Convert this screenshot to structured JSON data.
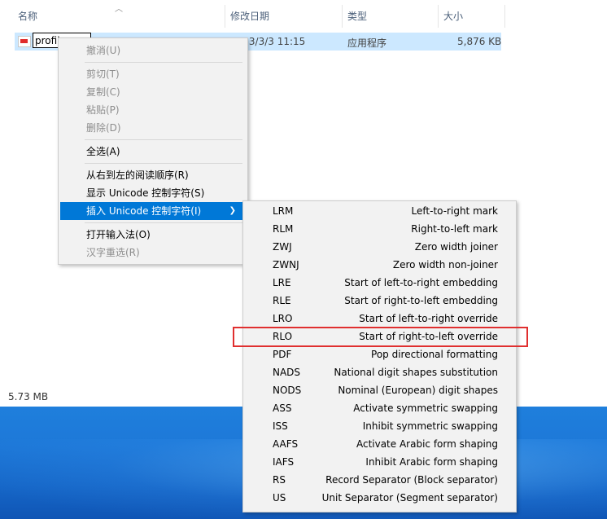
{
  "columns": {
    "name": "名称",
    "modified": "修改日期",
    "type": "类型",
    "size": "大小"
  },
  "file": {
    "rename_value": "profil",
    "modified": "2023/3/3 11:15",
    "type": "应用程序",
    "size": "5,876 KB"
  },
  "status": {
    "selected_size": "5.73 MB"
  },
  "context_menu": {
    "items": [
      {
        "label": "撤消(U)",
        "disabled": true
      },
      {
        "label": "剪切(T)",
        "disabled": true
      },
      {
        "label": "复制(C)",
        "disabled": true
      },
      {
        "label": "粘贴(P)",
        "disabled": true
      },
      {
        "label": "删除(D)",
        "disabled": true
      },
      {
        "label": "全选(A)",
        "disabled": false
      },
      {
        "label": "从右到左的阅读顺序(R)",
        "disabled": false
      },
      {
        "label": "显示 Unicode 控制字符(S)",
        "disabled": false
      },
      {
        "label": "插入 Unicode 控制字符(I)",
        "disabled": false,
        "highlighted": true,
        "submenu": true
      },
      {
        "label": "打开输入法(O)",
        "disabled": false
      },
      {
        "label": "汉字重选(R)",
        "disabled": true
      }
    ]
  },
  "submenu": {
    "items": [
      {
        "code": "LRM",
        "desc": "Left-to-right mark"
      },
      {
        "code": "RLM",
        "desc": "Right-to-left mark"
      },
      {
        "code": "ZWJ",
        "desc": "Zero width joiner"
      },
      {
        "code": "ZWNJ",
        "desc": "Zero width non-joiner"
      },
      {
        "code": "LRE",
        "desc": "Start of left-to-right embedding"
      },
      {
        "code": "RLE",
        "desc": "Start of right-to-left embedding"
      },
      {
        "code": "LRO",
        "desc": "Start of left-to-right override"
      },
      {
        "code": "RLO",
        "desc": "Start of right-to-left override",
        "boxed": true
      },
      {
        "code": "PDF",
        "desc": "Pop directional formatting"
      },
      {
        "code": "NADS",
        "desc": "National digit shapes substitution"
      },
      {
        "code": "NODS",
        "desc": "Nominal (European) digit shapes"
      },
      {
        "code": "ASS",
        "desc": "Activate symmetric swapping"
      },
      {
        "code": "ISS",
        "desc": "Inhibit symmetric swapping"
      },
      {
        "code": "AAFS",
        "desc": "Activate Arabic form shaping"
      },
      {
        "code": "IAFS",
        "desc": "Inhibit Arabic form shaping"
      },
      {
        "code": "RS",
        "desc": "Record Separator (Block separator)"
      },
      {
        "code": "US",
        "desc": "Unit Separator (Segment separator)"
      }
    ]
  },
  "colors": {
    "selection": "#cce8ff",
    "menu_highlight": "#0078d7",
    "annotation_box": "#e02f2f",
    "desktop": "#1d78d8"
  }
}
